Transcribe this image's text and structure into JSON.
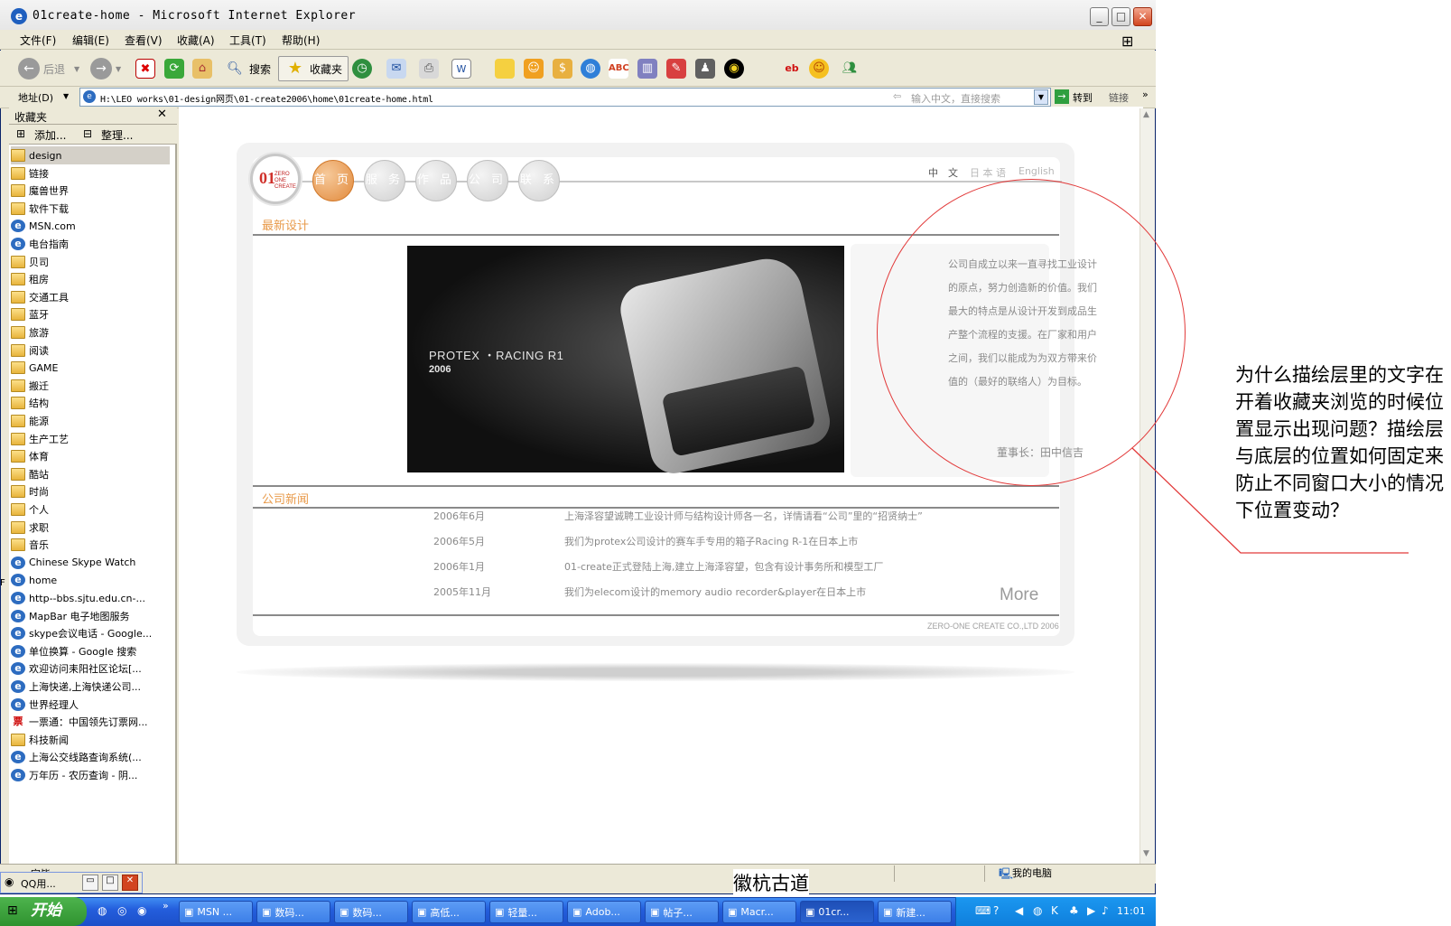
{
  "window": {
    "title": "01create-home - Microsoft Internet Explorer",
    "icon": "ie-icon"
  },
  "menu": [
    "文件(F)",
    "编辑(E)",
    "查看(V)",
    "收藏(A)",
    "工具(T)",
    "帮助(H)"
  ],
  "toolbar": {
    "back": "后退",
    "search": "搜索",
    "favorites": "收藏夹"
  },
  "address": {
    "label": "地址(D)",
    "url": "H:\\LEO works\\01-design网页\\01-create2006\\home\\01create-home.html",
    "search_placeholder": "输入中文，直接搜索",
    "go": "转到",
    "links": "链接"
  },
  "sidebar": {
    "title": "收藏夹",
    "add": "添加...",
    "organize": "整理...",
    "items": [
      {
        "label": "design",
        "type": "folder"
      },
      {
        "label": "链接",
        "type": "folder"
      },
      {
        "label": "魔兽世界",
        "type": "folder"
      },
      {
        "label": "软件下载",
        "type": "folder"
      },
      {
        "label": "MSN.com",
        "type": "ie"
      },
      {
        "label": "电台指南",
        "type": "ie"
      },
      {
        "label": "贝司",
        "type": "folder"
      },
      {
        "label": "租房",
        "type": "folder"
      },
      {
        "label": "交通工具",
        "type": "folder"
      },
      {
        "label": "蓝牙",
        "type": "folder"
      },
      {
        "label": "旅游",
        "type": "folder"
      },
      {
        "label": "阅读",
        "type": "folder"
      },
      {
        "label": "GAME",
        "type": "folder"
      },
      {
        "label": "搬迁",
        "type": "folder"
      },
      {
        "label": "结构",
        "type": "folder"
      },
      {
        "label": "能源",
        "type": "folder"
      },
      {
        "label": "生产工艺",
        "type": "folder"
      },
      {
        "label": "体育",
        "type": "folder"
      },
      {
        "label": "酷站",
        "type": "folder"
      },
      {
        "label": "时尚",
        "type": "folder"
      },
      {
        "label": "个人",
        "type": "folder"
      },
      {
        "label": "求职",
        "type": "folder"
      },
      {
        "label": "音乐",
        "type": "folder"
      },
      {
        "label": "Chinese Skype Watch",
        "type": "ie"
      },
      {
        "label": "home",
        "type": "ie"
      },
      {
        "label": "http--bbs.sjtu.edu.cn-...",
        "type": "ie"
      },
      {
        "label": "MapBar 电子地图服务",
        "type": "ie"
      },
      {
        "label": "skype会议电话 - Google...",
        "type": "ie"
      },
      {
        "label": "单位换算 - Google 搜索",
        "type": "ie"
      },
      {
        "label": "欢迎访问耒阳社区论坛[...",
        "type": "ie"
      },
      {
        "label": "上海快递,上海快递公司...",
        "type": "ie"
      },
      {
        "label": "世界经理人",
        "type": "ie"
      },
      {
        "label": "一票通：中国领先订票网...",
        "type": "ticket"
      },
      {
        "label": "科技新闻",
        "type": "folder"
      },
      {
        "label": "上海公交线路查询系统(...",
        "type": "ie"
      },
      {
        "label": "万年历 - 农历查询 - 阴...",
        "type": "ie"
      }
    ]
  },
  "site": {
    "nav": [
      "首 页",
      "服 务",
      "作 品",
      "公 司",
      "联 系"
    ],
    "lang": {
      "cn": "中　文",
      "jp": "日 本 语",
      "en": "English"
    },
    "latest_title": "最新设计",
    "hero_title": "PROTEX ・RACING R1",
    "hero_year": "2006",
    "intro": "公司自成立以来一直寻找工业设计的原点，努力创造新的价值。我们最大的特点是从设计开发到成品生产整个流程的支援。在厂家和用户之间，我们以能成为为双方带来价值的（最好的联络人）为目标。",
    "signature": "董事长：田中信吉",
    "news_title": "公司新闻",
    "news": [
      {
        "date": "2006年6月",
        "text": "上海泽容望诚聘工业设计师与结构设计师各一名，详情请看“公司”里的“招贤纳士”"
      },
      {
        "date": "2006年5月",
        "text": "我们为protex公司设计的赛车手专用的箱子Racing R-1在日本上市"
      },
      {
        "date": "2006年1月",
        "text": "01-create正式登陆上海,建立上海泽容望，包含有设计事务所和模型工厂"
      },
      {
        "date": "2005年11月",
        "text": "我们为elecom设计的memory audio recorder&player在日本上市"
      }
    ],
    "more": "More",
    "footer": "ZERO-ONE CREATE CO.,LTD 2006"
  },
  "annotation": "为什么描绘层里的文字在开着收藏夹浏览的时候位置显示出现问题？描绘层与底层的位置如何固定来防止不同窗口大小的情况下位置变动？",
  "status": {
    "left": "完毕",
    "right": "我的电脑"
  },
  "bottom_text": "徽杭古道",
  "qq_window": "QQ用...",
  "taskbar": {
    "start": "开始",
    "items": [
      "MSN ...",
      "数码...",
      "数码...",
      "高低...",
      "轻量...",
      "Adob...",
      "帖子...",
      "Macr...",
      "01cr...",
      "新建..."
    ],
    "active_index": 8,
    "clock": "11:01"
  },
  "colors": {
    "accent_orange": "#E28A3C",
    "annotation_red": "#E23A3A",
    "xp_blue": "#245EDC"
  }
}
